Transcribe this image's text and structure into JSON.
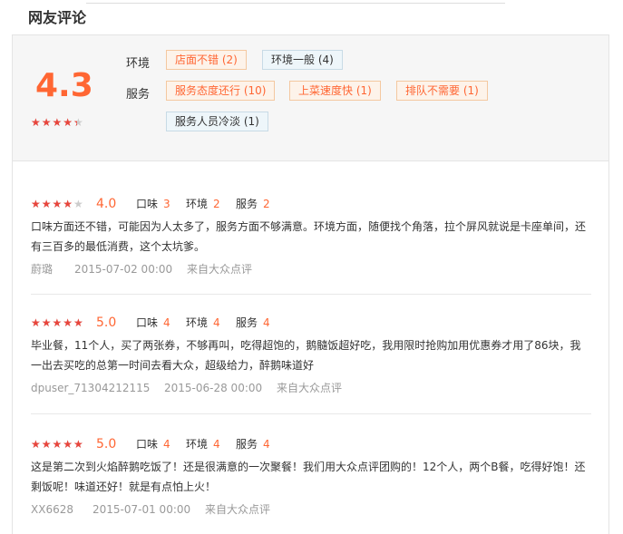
{
  "section_title": "网友评论",
  "summary": {
    "score": "4.3",
    "rating": 0.86,
    "stars_glyphs": "★★★★★",
    "env_label": "环境",
    "service_label": "服务",
    "env_tags": [
      {
        "text": "店面不错 (2)",
        "type": "positive"
      },
      {
        "text": "环境一般 (4)",
        "type": "neutral"
      }
    ],
    "service_tags": [
      {
        "text": "服务态度还行 (10)",
        "type": "positive"
      },
      {
        "text": "上菜速度快 (1)",
        "type": "positive"
      },
      {
        "text": "排队不需要 (1)",
        "type": "positive"
      },
      {
        "text": "服务人员冷淡 (1)",
        "type": "neutral"
      }
    ]
  },
  "sub_labels": {
    "taste": "口味",
    "env": "环境",
    "service": "服务"
  },
  "reviews": [
    {
      "rating": 0.8,
      "score": "4.0",
      "taste": "3",
      "env": "2",
      "service": "2",
      "text": "口味方面还不错，可能因为人太多了，服务方面不够满意。环境方面，随便找个角落，拉个屏风就说是卡座单间，还有三百多的最低消费，这个太坑爹。",
      "user": "蔚璐",
      "date": "2015-07-02 00:00",
      "source": "来自大众点评"
    },
    {
      "rating": 1.0,
      "score": "5.0",
      "taste": "4",
      "env": "4",
      "service": "4",
      "text": "毕业餐，11个人，买了两张券，不够再叫，吃得超饱的，鹅髓饭超好吃，我用限时抢购加用优惠券才用了86块，我一出去买吃的总第一时间去看大众，超级给力，醉鹅味道好",
      "user": "dpuser_71304212115",
      "date": "2015-06-28 00:00",
      "source": "来自大众点评"
    },
    {
      "rating": 1.0,
      "score": "5.0",
      "taste": "4",
      "env": "4",
      "service": "4",
      "text": "这是第二次到火焰醉鹅吃饭了！还是很满意的一次聚餐！我们用大众点评团购的！12个人，两个B餐，吃得好饱！还剩饭呢！味道还好！就是有点怕上火！",
      "user": "XX6628",
      "date": "2015-07-01 00:00",
      "source": "来自大众点评"
    }
  ],
  "colors": {
    "accent": "#ff6633",
    "star": "#e8453c"
  }
}
